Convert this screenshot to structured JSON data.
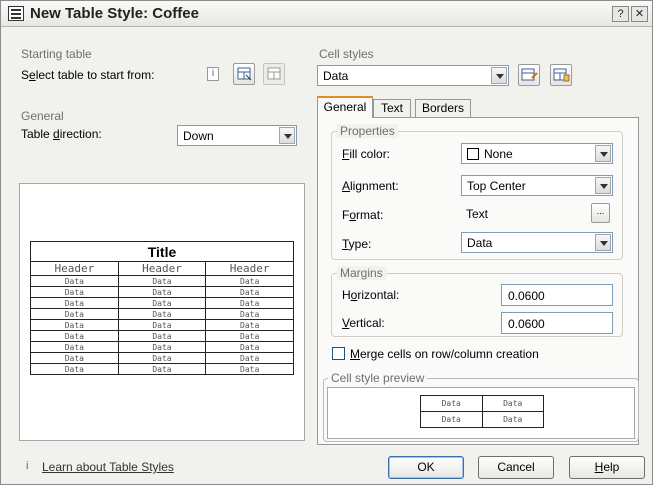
{
  "window": {
    "title": "New Table Style: Coffee",
    "help_glyph": "?",
    "close_glyph": "✕"
  },
  "starting": {
    "group": "Starting table",
    "label_pre": "S",
    "label_u": "e",
    "label_post": "lect table to start from:"
  },
  "general": {
    "group": "General",
    "dir_pre": "Table ",
    "dir_u": "d",
    "dir_post": "irection:",
    "direction": "Down"
  },
  "preview": {
    "title": "Title",
    "headers": [
      "Header",
      "Header",
      "Header"
    ],
    "rows": [
      [
        "Data",
        "Data",
        "Data"
      ],
      [
        "Data",
        "Data",
        "Data"
      ],
      [
        "Data",
        "Data",
        "Data"
      ],
      [
        "Data",
        "Data",
        "Data"
      ],
      [
        "Data",
        "Data",
        "Data"
      ],
      [
        "Data",
        "Data",
        "Data"
      ],
      [
        "Data",
        "Data",
        "Data"
      ],
      [
        "Data",
        "Data",
        "Data"
      ],
      [
        "Data",
        "Data",
        "Data"
      ]
    ]
  },
  "cellstyles": {
    "group": "Cell styles",
    "selected": "Data"
  },
  "tabs": [
    "General",
    "Text",
    "Borders"
  ],
  "props": {
    "group": "Properties",
    "fill_u": "F",
    "fill_post": "ill color:",
    "fill": "None",
    "align_u": "A",
    "align_post": "lignment:",
    "align": "Top Center",
    "format_pre": "F",
    "format_u": "o",
    "format_post": "rmat:",
    "format": "Text",
    "format_btn": "...",
    "type_u": "T",
    "type_post": "ype:",
    "type": "Data"
  },
  "margins": {
    "group": "Margins",
    "h_pre": "H",
    "h_u": "o",
    "h_post": "rizontal:",
    "h": "0.0600",
    "v_u": "V",
    "v_post": "ertical:",
    "v": "0.0600"
  },
  "merge": {
    "u": "M",
    "post": "erge cells on row/column creation"
  },
  "csp": {
    "group": "Cell style preview",
    "cells": [
      [
        "Data",
        "Data"
      ],
      [
        "Data",
        "Data"
      ]
    ]
  },
  "footer": {
    "info_glyph": "i",
    "link": "Learn about Table Styles",
    "ok": "OK",
    "cancel": "Cancel",
    "help_u": "H",
    "help_post": "elp"
  }
}
